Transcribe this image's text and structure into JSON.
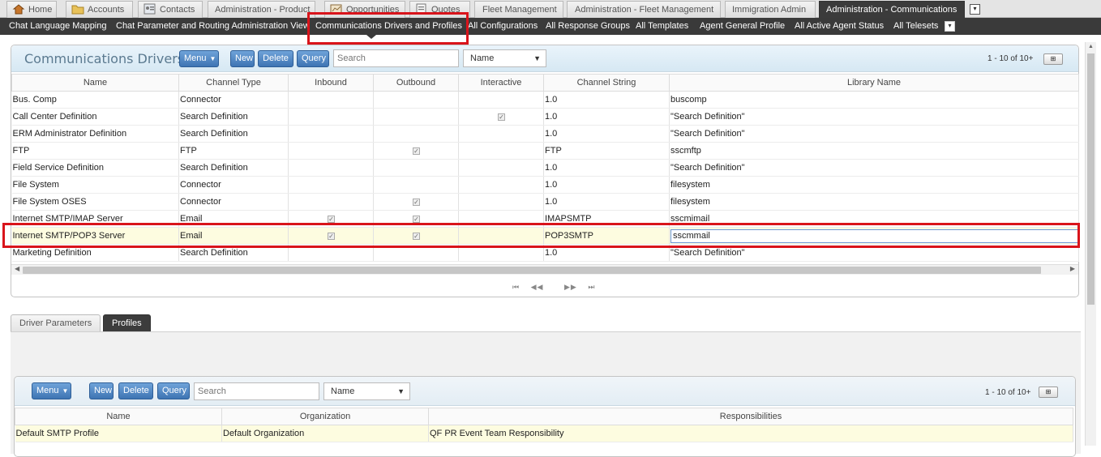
{
  "tabs": [
    {
      "label": "Home",
      "icon": "home-icon"
    },
    {
      "label": "Accounts",
      "icon": "folder-icon"
    },
    {
      "label": "Contacts",
      "icon": "contacts-icon"
    },
    {
      "label": "Administration - Product",
      "icon": ""
    },
    {
      "label": "Opportunities",
      "icon": "opportunities-icon"
    },
    {
      "label": "Quotes",
      "icon": "quotes-icon"
    },
    {
      "label": "Fleet Management",
      "icon": ""
    },
    {
      "label": "Administration - Fleet Management",
      "icon": ""
    },
    {
      "label": "Immigration Admin",
      "icon": ""
    },
    {
      "label": "Administration - Communications",
      "icon": ""
    }
  ],
  "more_glyph": "▾",
  "subnav": [
    "Chat Language Mapping",
    "Chat Parameter and Routing Administration View",
    "Communications Drivers and Profiles",
    "All Configurations",
    "All Response Groups",
    "All Templates",
    "Agent General Profile",
    "All Active Agent Status",
    "All Telesets"
  ],
  "drivers": {
    "title": "Communications Drivers",
    "menu_label": "Menu",
    "new_label": "New",
    "delete_label": "Delete",
    "query_label": "Query",
    "search_placeholder": "Search",
    "search_field_value": "Name",
    "record_count": "1 - 10 of 10+",
    "columns": [
      "Name",
      "Channel Type",
      "Inbound",
      "Outbound",
      "Interactive",
      "Channel String",
      "Library Name"
    ],
    "rows": [
      {
        "name": "Bus. Comp",
        "channel_type": "Connector",
        "inbound": false,
        "outbound": false,
        "interactive": false,
        "channel_string": "1.0",
        "library": "buscomp"
      },
      {
        "name": "Call Center Definition",
        "channel_type": "Search Definition",
        "inbound": false,
        "outbound": false,
        "interactive": true,
        "channel_string": "1.0",
        "library": "\"Search Definition\""
      },
      {
        "name": "ERM Administrator Definition",
        "channel_type": "Search Definition",
        "inbound": false,
        "outbound": false,
        "interactive": false,
        "channel_string": "1.0",
        "library": "\"Search Definition\""
      },
      {
        "name": "FTP",
        "channel_type": "FTP",
        "inbound": false,
        "outbound": true,
        "interactive": false,
        "channel_string": "FTP",
        "library": "sscmftp"
      },
      {
        "name": "Field Service Definition",
        "channel_type": "Search Definition",
        "inbound": false,
        "outbound": false,
        "interactive": false,
        "channel_string": "1.0",
        "library": "\"Search Definition\""
      },
      {
        "name": "File System",
        "channel_type": "Connector",
        "inbound": false,
        "outbound": false,
        "interactive": false,
        "channel_string": "1.0",
        "library": "filesystem"
      },
      {
        "name": "File System OSES",
        "channel_type": "Connector",
        "inbound": false,
        "outbound": true,
        "interactive": false,
        "channel_string": "1.0",
        "library": "filesystem"
      },
      {
        "name": "Internet SMTP/IMAP Server",
        "channel_type": "Email",
        "inbound": true,
        "outbound": true,
        "interactive": false,
        "channel_string": "IMAPSMTP",
        "library": "sscmimail"
      },
      {
        "name": "Internet SMTP/POP3 Server",
        "channel_type": "Email",
        "inbound": true,
        "outbound": true,
        "interactive": false,
        "channel_string": "POP3SMTP",
        "library": "sscmmail"
      },
      {
        "name": "Marketing Definition",
        "channel_type": "Search Definition",
        "inbound": false,
        "outbound": false,
        "interactive": false,
        "channel_string": "1.0",
        "library": "\"Search Definition\""
      }
    ],
    "selected_row_index": 8,
    "pager": {
      "first": "⏮",
      "prev": "◀◀",
      "next": "▶▶",
      "last": "⏭"
    }
  },
  "subtabs": [
    "Driver Parameters",
    "Profiles"
  ],
  "profiles": {
    "menu_label": "Menu",
    "new_label": "New",
    "delete_label": "Delete",
    "query_label": "Query",
    "search_placeholder": "Search",
    "search_field_value": "Name",
    "record_count": "1 - 10 of 10+",
    "columns": [
      "Name",
      "Organization",
      "Responsibilities"
    ],
    "rows": [
      {
        "name": "Default SMTP Profile",
        "organization": "Default Organization",
        "responsibilities": "QF PR Event Team Responsibility"
      }
    ]
  },
  "colors": {
    "highlight": "#d9141b",
    "button": "#4a80c0",
    "selected_row": "#fdfce0",
    "nav_dark": "#3a3a3a"
  }
}
